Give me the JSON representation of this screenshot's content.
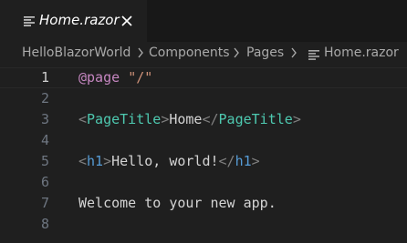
{
  "tab": {
    "title": "Home.razor",
    "file_icon": "file-lines-icon",
    "close_icon": "close-icon"
  },
  "breadcrumb": {
    "items": [
      "HelloBlazorWorld",
      "Components",
      "Pages",
      "Home.razor"
    ],
    "separator_icon": "chevron-right-icon",
    "file_icon": "file-lines-icon"
  },
  "editor": {
    "active_line": 1,
    "lines": [
      {
        "number": "1",
        "tokens": [
          {
            "t": "@page",
            "c": "directive"
          },
          {
            "t": " ",
            "c": "text"
          },
          {
            "t": "\"/\"",
            "c": "string"
          }
        ]
      },
      {
        "number": "2",
        "tokens": []
      },
      {
        "number": "3",
        "tokens": [
          {
            "t": "<",
            "c": "bracket"
          },
          {
            "t": "PageTitle",
            "c": "tag"
          },
          {
            "t": ">",
            "c": "bracket"
          },
          {
            "t": "Home",
            "c": "text"
          },
          {
            "t": "</",
            "c": "bracket"
          },
          {
            "t": "PageTitle",
            "c": "tag"
          },
          {
            "t": ">",
            "c": "bracket"
          }
        ]
      },
      {
        "number": "4",
        "tokens": []
      },
      {
        "number": "5",
        "tokens": [
          {
            "t": "<",
            "c": "bracket"
          },
          {
            "t": "h1",
            "c": "tag2"
          },
          {
            "t": ">",
            "c": "bracket"
          },
          {
            "t": "Hello, world!",
            "c": "text"
          },
          {
            "t": "</",
            "c": "bracket"
          },
          {
            "t": "h1",
            "c": "tag2"
          },
          {
            "t": ">",
            "c": "bracket"
          }
        ]
      },
      {
        "number": "6",
        "tokens": []
      },
      {
        "number": "7",
        "tokens": [
          {
            "t": "Welcome to your new app.",
            "c": "text"
          }
        ]
      },
      {
        "number": "8",
        "tokens": []
      }
    ]
  },
  "colors": {
    "directive": "#c586c0",
    "string": "#ce9178",
    "tag": "#4ec9b0",
    "tag_html": "#569cd6",
    "bracket": "#808080",
    "text": "#d4d4d4",
    "background": "#1f1f1f"
  }
}
